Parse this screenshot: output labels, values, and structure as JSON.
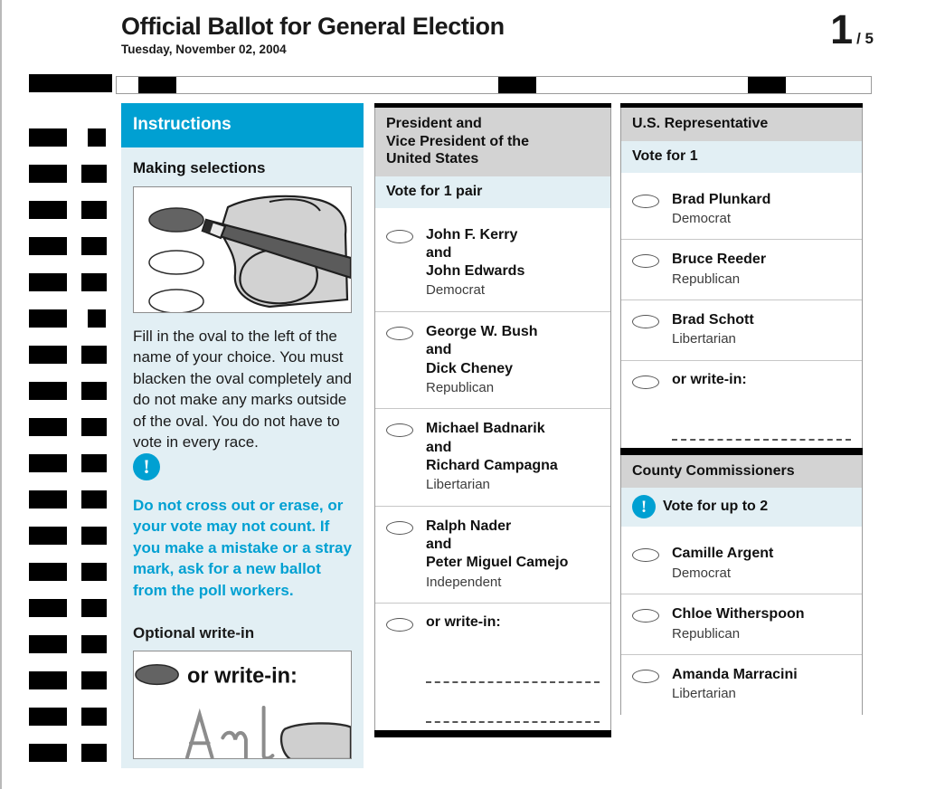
{
  "header": {
    "title": "Official Ballot for General Election",
    "date": "Tuesday, November 02, 2004",
    "page_number": "1",
    "page_of": "/ 5"
  },
  "colors": {
    "accent_cyan": "#00a0d2",
    "contest_header_gray": "#d3d3d3",
    "vote_for_band": "#e2eff4",
    "rule_black": "#000000"
  },
  "instructions": {
    "header": "Instructions",
    "section_title": "Making selections",
    "illustration_alt": "hand-with-pencil-filling-oval",
    "body": "Fill in the oval to the left of the name of your choice. You must blacken the oval completely and do not make any marks outside of the oval. You do not have to vote in every race.",
    "warning_icon": "exclamation-circle-icon",
    "warning": "Do not cross out or erase, or your vote may not count. If you make a mistake or a stray mark, ask for a new ballot from the poll workers.",
    "writein_section_title": "Optional write-in",
    "writein_example_label": "or write-in:"
  },
  "contests": [
    {
      "id": "president",
      "title": "President and\nVice President of the\nUnited States",
      "title_lines": [
        "President and",
        "Vice President of the",
        "United States"
      ],
      "vote_for": "Vote for 1 pair",
      "vote_for_has_icon": false,
      "candidates": [
        {
          "name_lines": [
            "John F. Kerry",
            "and",
            "John Edwards"
          ],
          "party": "Democrat"
        },
        {
          "name_lines": [
            "George W. Bush",
            "and",
            "Dick Cheney"
          ],
          "party": "Republican"
        },
        {
          "name_lines": [
            "Michael Badnarik",
            "and",
            "Richard Campagna"
          ],
          "party": "Libertarian"
        },
        {
          "name_lines": [
            "Ralph Nader",
            "and",
            "Peter Miguel Camejo"
          ],
          "party": "Independent"
        }
      ],
      "writein_label": "or write-in:",
      "writein_lines": 2
    },
    {
      "id": "us-representative",
      "title_lines": [
        "U.S. Representative"
      ],
      "vote_for": "Vote for 1",
      "vote_for_has_icon": false,
      "candidates": [
        {
          "name_lines": [
            "Brad Plunkard"
          ],
          "party": "Democrat"
        },
        {
          "name_lines": [
            "Bruce Reeder"
          ],
          "party": "Republican"
        },
        {
          "name_lines": [
            "Brad Schott"
          ],
          "party": "Libertarian"
        }
      ],
      "writein_label": "or write-in:",
      "writein_lines": 1
    },
    {
      "id": "county-commissioners",
      "title_lines": [
        "County Commissioners"
      ],
      "vote_for": "Vote for up to 2",
      "vote_for_has_icon": true,
      "vote_for_icon": "exclamation-circle-icon",
      "candidates": [
        {
          "name_lines": [
            "Camille Argent"
          ],
          "party": "Democrat"
        },
        {
          "name_lines": [
            "Chloe Witherspoon"
          ],
          "party": "Republican"
        },
        {
          "name_lines": [
            "Amanda Marracini"
          ],
          "party": "Libertarian"
        }
      ]
    }
  ]
}
